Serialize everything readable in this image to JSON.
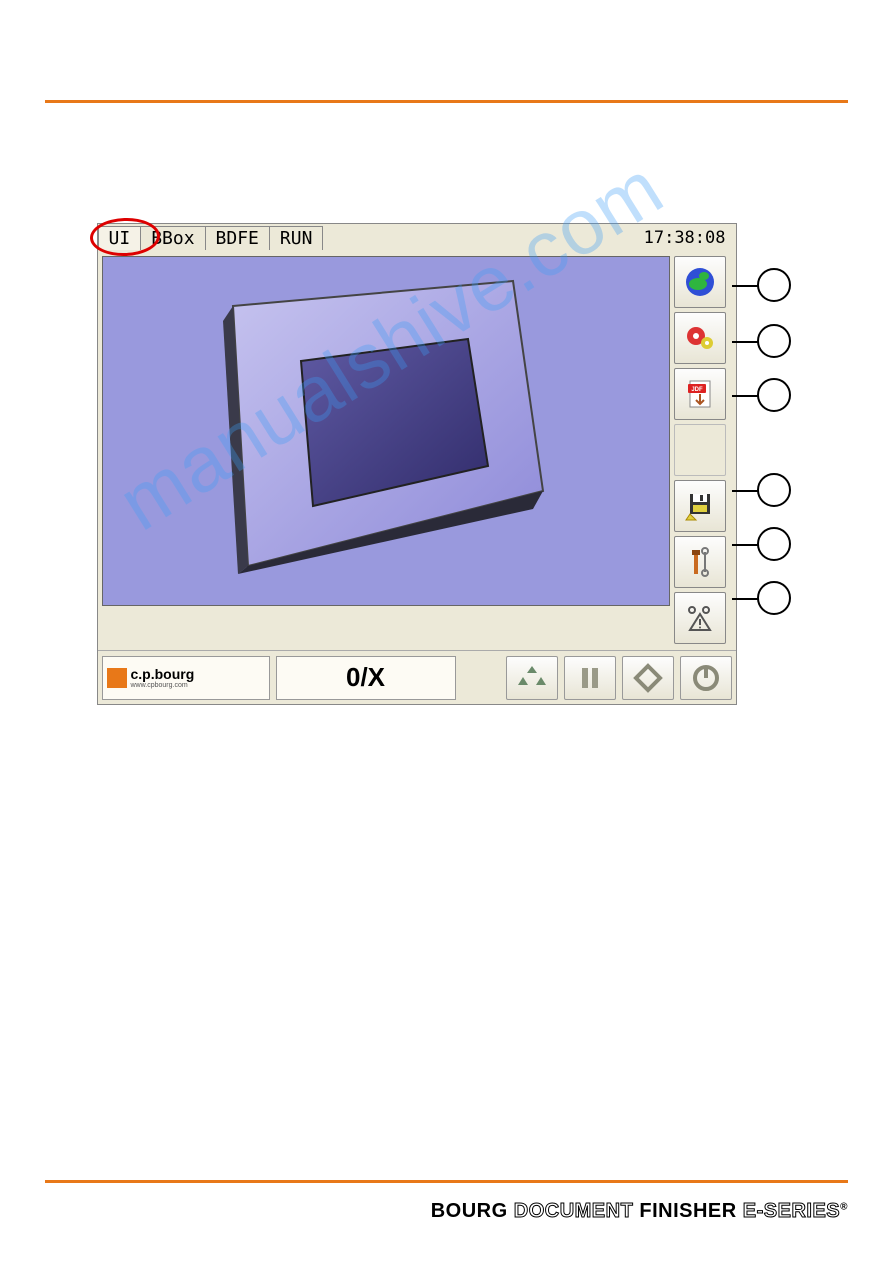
{
  "tabs": [
    "UI",
    "BBox",
    "BDFE",
    "RUN"
  ],
  "active_tab": "UI",
  "clock": "17:38:08",
  "counter": "0/X",
  "logo": {
    "brand": "c.p.bourg",
    "url": "www.cpbourg.com"
  },
  "side_icons": [
    "globe-icon",
    "gears-icon",
    "pdf-icon",
    "empty",
    "save-icon",
    "tools-icon",
    "warning-icon"
  ],
  "bottom_icons": [
    "recycle-icon",
    "pause-icon",
    "play-icon",
    "stop-icon"
  ],
  "footer": {
    "b1": "BOURG",
    "b2": "DOCUMENT",
    "b3": "FINISHER",
    "b4": "E-SERIES",
    "reg": "®"
  },
  "watermark": "manualshive.com"
}
